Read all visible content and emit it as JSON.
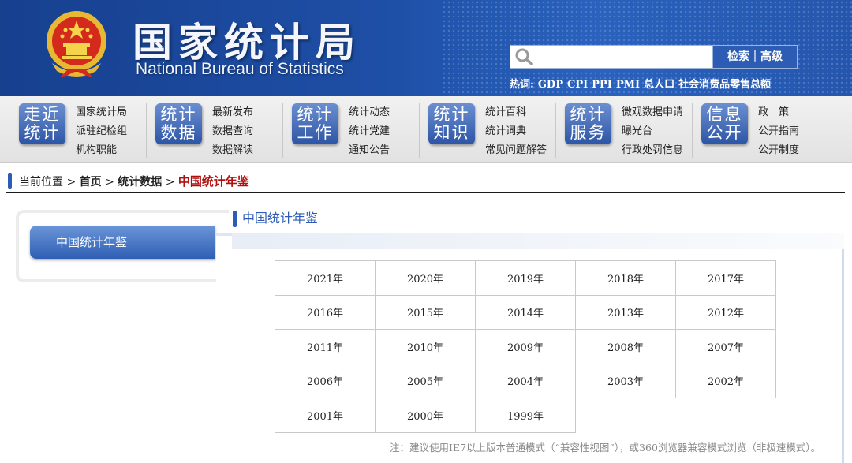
{
  "header": {
    "title_cn": "国家统计局",
    "title_en": "National Bureau of Statistics",
    "search_placeholder": "",
    "search_button": "检索｜高级",
    "hotwords_label": "热词:",
    "hotwords": [
      "GDP",
      "CPI",
      "PPI",
      "PMI",
      "总人口",
      "社会消费品零售总额"
    ]
  },
  "nav": [
    {
      "tile": [
        "走近",
        "统计"
      ],
      "links": [
        "国家统计局",
        "派驻纪检组",
        "机构职能"
      ]
    },
    {
      "tile": [
        "统计",
        "数据"
      ],
      "links": [
        "最新发布",
        "数据查询",
        "数据解读"
      ]
    },
    {
      "tile": [
        "统计",
        "工作"
      ],
      "links": [
        "统计动态",
        "统计党建",
        "通知公告"
      ]
    },
    {
      "tile": [
        "统计",
        "知识"
      ],
      "links": [
        "统计百科",
        "统计词典",
        "常见问题解答"
      ]
    },
    {
      "tile": [
        "统计",
        "服务"
      ],
      "links": [
        "微观数据申请",
        "曝光台",
        "行政处罚信息"
      ]
    },
    {
      "tile": [
        "信息",
        "公开"
      ],
      "links": [
        "政　策",
        "公开指南",
        "公开制度"
      ]
    }
  ],
  "breadcrumb": {
    "label": "当前位置 >",
    "home": "首页",
    "sep1": ">",
    "data": "统计数据",
    "sep2": ">",
    "current": "中国统计年鉴"
  },
  "sidebar": {
    "item": "中国统计年鉴"
  },
  "main": {
    "title": "中国统计年鉴",
    "years": [
      [
        "2021年",
        "2020年",
        "2019年",
        "2018年",
        "2017年"
      ],
      [
        "2016年",
        "2015年",
        "2014年",
        "2013年",
        "2012年"
      ],
      [
        "2011年",
        "2010年",
        "2009年",
        "2008年",
        "2007年"
      ],
      [
        "2006年",
        "2005年",
        "2004年",
        "2003年",
        "2002年"
      ],
      [
        "2001年",
        "2000年",
        "1999年",
        "",
        ""
      ]
    ],
    "note": "注：建议使用IE7以上版本普通模式（“兼容性视图”），或360浏览器兼容模式浏览（非极速模式）。"
  },
  "colors": {
    "brand_blue": "#1e4fa6",
    "current_red": "#b01010",
    "accent": "#2d5cb4"
  }
}
